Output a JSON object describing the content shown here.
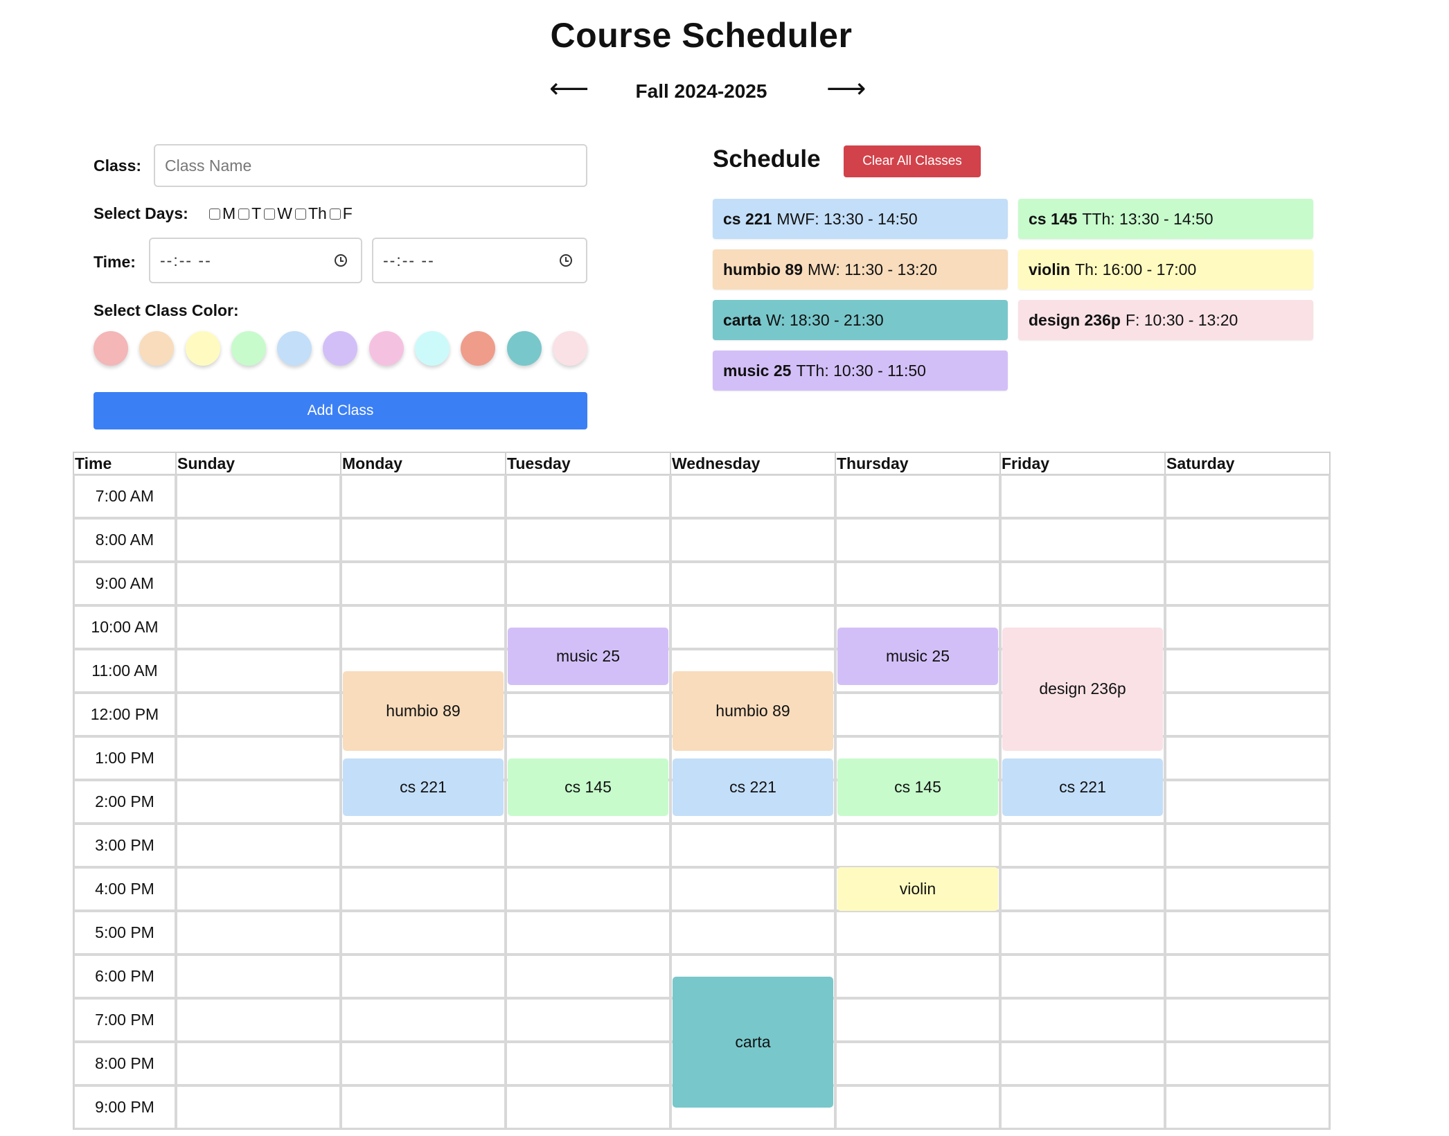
{
  "app": {
    "title": "Course Scheduler",
    "term": "Fall 2024-2025",
    "prev_arrow": "⟵",
    "next_arrow": "⟶"
  },
  "form": {
    "class_label": "Class:",
    "class_placeholder": "Class Name",
    "days_label": "Select Days:",
    "days": [
      "M",
      "T",
      "W",
      "Th",
      "F"
    ],
    "time_label": "Time:",
    "time_start_value": "--:--  --",
    "time_end_value": "--:--  --",
    "color_label": "Select Class Color:",
    "colors": [
      "#f4b6b7",
      "#f8dcbc",
      "#fffbc0",
      "#c7fbcc",
      "#c3def8",
      "#d2bff7",
      "#f5c1e1",
      "#ccfafb",
      "#ef9c8b",
      "#78c7cb",
      "#f9e1e6"
    ],
    "add_button": "Add Class"
  },
  "schedule": {
    "title": "Schedule",
    "clear_button": "Clear All Classes",
    "classes": [
      {
        "name": "cs 221",
        "detail": "MWF: 13:30 - 14:50",
        "color": "#c3def8"
      },
      {
        "name": "cs 145",
        "detail": "TTh: 13:30 - 14:50",
        "color": "#c7fbcc"
      },
      {
        "name": "humbio 89",
        "detail": "MW: 11:30 - 13:20",
        "color": "#f8dcbc"
      },
      {
        "name": "violin",
        "detail": "Th: 16:00 - 17:00",
        "color": "#fffbc0"
      },
      {
        "name": "carta",
        "detail": "W: 18:30 - 21:30",
        "color": "#78c7cb"
      },
      {
        "name": "design 236p",
        "detail": "F: 10:30 - 13:20",
        "color": "#f9e1e6"
      },
      {
        "name": "music 25",
        "detail": "TTh: 10:30 - 11:50",
        "color": "#d2bff7"
      }
    ]
  },
  "calendar": {
    "time_header": "Time",
    "days": [
      "Sunday",
      "Monday",
      "Tuesday",
      "Wednesday",
      "Thursday",
      "Friday",
      "Saturday"
    ],
    "hours": [
      "7:00 AM",
      "8:00 AM",
      "9:00 AM",
      "10:00 AM",
      "11:00 AM",
      "12:00 PM",
      "1:00 PM",
      "2:00 PM",
      "3:00 PM",
      "4:00 PM",
      "5:00 PM",
      "6:00 PM",
      "7:00 PM",
      "8:00 PM",
      "9:00 PM"
    ],
    "first_hour": 7,
    "blocks": [
      {
        "label": "music 25",
        "day": 2,
        "start": 10.5,
        "end": 11.8333,
        "color": "#d2bff7"
      },
      {
        "label": "music 25",
        "day": 4,
        "start": 10.5,
        "end": 11.8333,
        "color": "#d2bff7"
      },
      {
        "label": "humbio 89",
        "day": 1,
        "start": 11.5,
        "end": 13.3333,
        "color": "#f8dcbc"
      },
      {
        "label": "humbio 89",
        "day": 3,
        "start": 11.5,
        "end": 13.3333,
        "color": "#f8dcbc"
      },
      {
        "label": "design 236p",
        "day": 5,
        "start": 10.5,
        "end": 13.3333,
        "color": "#f9e1e6"
      },
      {
        "label": "cs 221",
        "day": 1,
        "start": 13.5,
        "end": 14.8333,
        "color": "#c3def8"
      },
      {
        "label": "cs 221",
        "day": 3,
        "start": 13.5,
        "end": 14.8333,
        "color": "#c3def8"
      },
      {
        "label": "cs 221",
        "day": 5,
        "start": 13.5,
        "end": 14.8333,
        "color": "#c3def8"
      },
      {
        "label": "cs 145",
        "day": 2,
        "start": 13.5,
        "end": 14.8333,
        "color": "#c7fbcc"
      },
      {
        "label": "cs 145",
        "day": 4,
        "start": 13.5,
        "end": 14.8333,
        "color": "#c7fbcc"
      },
      {
        "label": "violin",
        "day": 4,
        "start": 16,
        "end": 17,
        "color": "#fffbc0"
      },
      {
        "label": "carta",
        "day": 3,
        "start": 18.5,
        "end": 21.5,
        "color": "#78c7cb"
      }
    ]
  }
}
